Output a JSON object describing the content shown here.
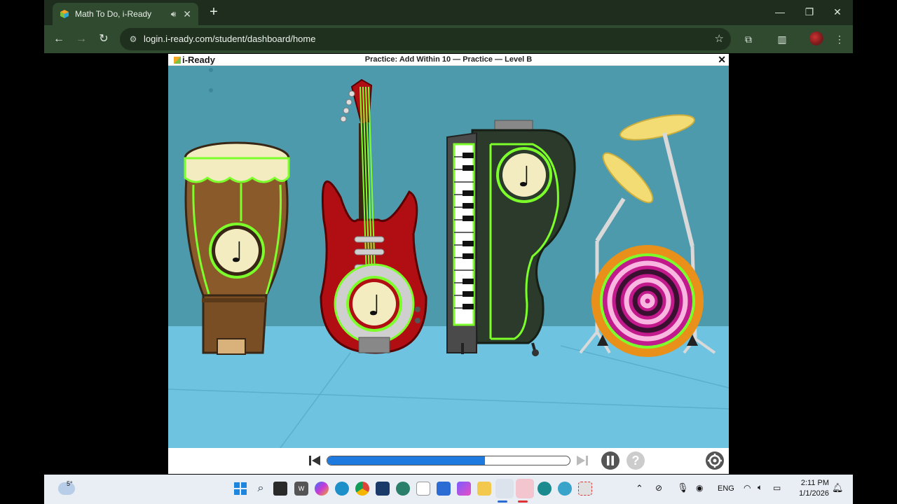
{
  "browser": {
    "tab": {
      "title": "Math To Do, i-Ready",
      "audio_icon": "speaker-icon",
      "close": "✕"
    },
    "new_tab": "+",
    "window_controls": {
      "minimize": "—",
      "restore": "❐",
      "close": "✕"
    },
    "nav": {
      "back": "←",
      "forward": "→",
      "reload": "↻"
    },
    "url": "login.i-ready.com/student/dashboard/home",
    "star": "☆"
  },
  "player": {
    "logo": "i-Ready",
    "title": "Practice: Add Within 10 — Practice — Level B",
    "close": "✕",
    "progress": 0.65,
    "help": "?"
  },
  "scene": {
    "background": "#4d9aad",
    "floor": "#6ec3e0",
    "note_glyph": "♩",
    "instruments": [
      "drum",
      "guitar",
      "keyboard",
      "drum-kit"
    ],
    "highlight_color": "#7cff2a"
  },
  "taskbar": {
    "weather": "5°",
    "language": "ENG",
    "time": "2:11 PM",
    "date": "1/1/2026"
  }
}
